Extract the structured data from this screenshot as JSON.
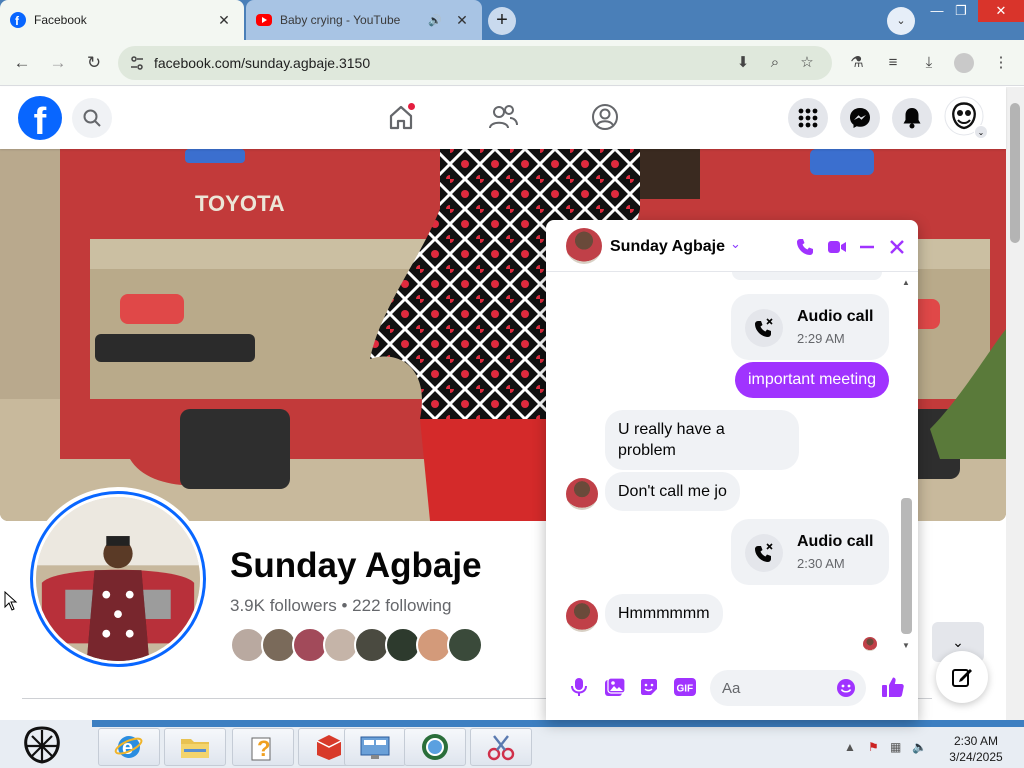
{
  "browser": {
    "tabs": [
      {
        "title": "Facebook",
        "active": true,
        "favicon": "facebook-icon"
      },
      {
        "title": "Baby crying - YouTube",
        "active": false,
        "favicon": "youtube-icon",
        "audio": true
      }
    ],
    "url": "facebook.com/sunday.agbaje.3150"
  },
  "facebook": {
    "profile": {
      "name": "Sunday Agbaje",
      "followers_line": "3.9K followers • 222 following"
    }
  },
  "chat": {
    "contact_name": "Sunday Agbaje",
    "messages": [
      {
        "type": "call",
        "direction": "outgoing",
        "title": "Audio call",
        "time": "2:29 AM"
      },
      {
        "type": "text",
        "direction": "outgoing",
        "text": "important meeting"
      },
      {
        "type": "text",
        "direction": "incoming",
        "text": "U really have a problem"
      },
      {
        "type": "text",
        "direction": "incoming",
        "text": "Don't call me jo"
      },
      {
        "type": "call",
        "direction": "outgoing",
        "title": "Audio call",
        "time": "2:30 AM"
      },
      {
        "type": "text",
        "direction": "incoming",
        "text": "Hmmmmmm"
      }
    ],
    "input_placeholder": "Aa"
  },
  "taskbar": {
    "time": "2:30 AM",
    "date": "3/24/2025"
  },
  "colors": {
    "facebook_blue": "#0866ff",
    "messenger_purple": "#a033ff",
    "tab_strip": "#4a7fb8"
  }
}
